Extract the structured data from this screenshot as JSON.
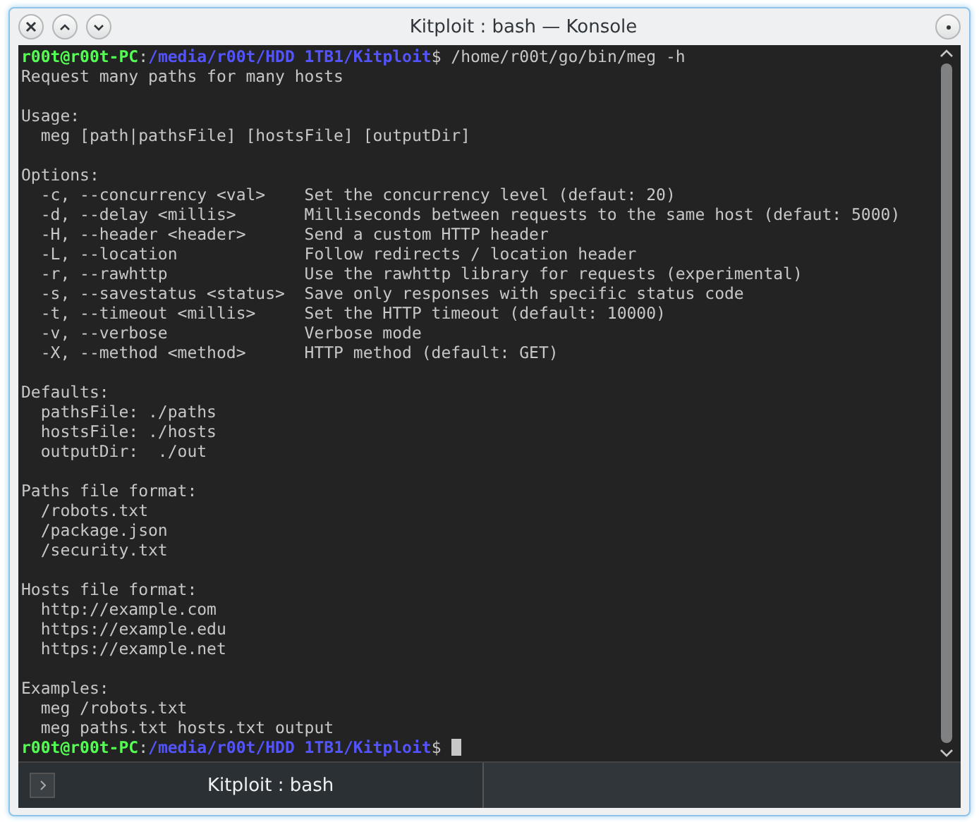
{
  "window": {
    "title": "Kitploit : bash — Konsole"
  },
  "terminal": {
    "lines": [
      {
        "kind": "prompt",
        "user": "r00t@r00t-PC",
        "separator": ":",
        "path": "/media/r00t/HDD 1TB1/Kitploit",
        "command": "$ /home/r00t/go/bin/meg -h",
        "cursor": false
      },
      {
        "kind": "text",
        "text": "Request many paths for many hosts"
      },
      {
        "kind": "blank"
      },
      {
        "kind": "text",
        "text": "Usage:"
      },
      {
        "kind": "text",
        "text": "  meg [path|pathsFile] [hostsFile] [outputDir]"
      },
      {
        "kind": "blank"
      },
      {
        "kind": "text",
        "text": "Options:"
      },
      {
        "kind": "text",
        "text": "  -c, --concurrency <val>    Set the concurrency level (defaut: 20)"
      },
      {
        "kind": "text",
        "text": "  -d, --delay <millis>       Milliseconds between requests to the same host (defaut: 5000)"
      },
      {
        "kind": "text",
        "text": "  -H, --header <header>      Send a custom HTTP header"
      },
      {
        "kind": "text",
        "text": "  -L, --location             Follow redirects / location header"
      },
      {
        "kind": "text",
        "text": "  -r, --rawhttp              Use the rawhttp library for requests (experimental)"
      },
      {
        "kind": "text",
        "text": "  -s, --savestatus <status>  Save only responses with specific status code"
      },
      {
        "kind": "text",
        "text": "  -t, --timeout <millis>     Set the HTTP timeout (default: 10000)"
      },
      {
        "kind": "text",
        "text": "  -v, --verbose              Verbose mode"
      },
      {
        "kind": "text",
        "text": "  -X, --method <method>      HTTP method (default: GET)"
      },
      {
        "kind": "blank"
      },
      {
        "kind": "text",
        "text": "Defaults:"
      },
      {
        "kind": "text",
        "text": "  pathsFile: ./paths"
      },
      {
        "kind": "text",
        "text": "  hostsFile: ./hosts"
      },
      {
        "kind": "text",
        "text": "  outputDir:  ./out"
      },
      {
        "kind": "blank"
      },
      {
        "kind": "text",
        "text": "Paths file format:"
      },
      {
        "kind": "text",
        "text": "  /robots.txt"
      },
      {
        "kind": "text",
        "text": "  /package.json"
      },
      {
        "kind": "text",
        "text": "  /security.txt"
      },
      {
        "kind": "blank"
      },
      {
        "kind": "text",
        "text": "Hosts file format:"
      },
      {
        "kind": "text",
        "text": "  http://example.com"
      },
      {
        "kind": "text",
        "text": "  https://example.edu"
      },
      {
        "kind": "text",
        "text": "  https://example.net"
      },
      {
        "kind": "blank"
      },
      {
        "kind": "text",
        "text": "Examples:"
      },
      {
        "kind": "text",
        "text": "  meg /robots.txt"
      },
      {
        "kind": "text",
        "text": "  meg paths.txt hosts.txt output"
      },
      {
        "kind": "prompt",
        "user": "r00t@r00t-PC",
        "separator": ":",
        "path": "/media/r00t/HDD 1TB1/Kitploit",
        "command": "$",
        "cursor": true
      }
    ]
  },
  "tabs": [
    {
      "label": "Kitploit : bash",
      "selected": true
    }
  ]
}
